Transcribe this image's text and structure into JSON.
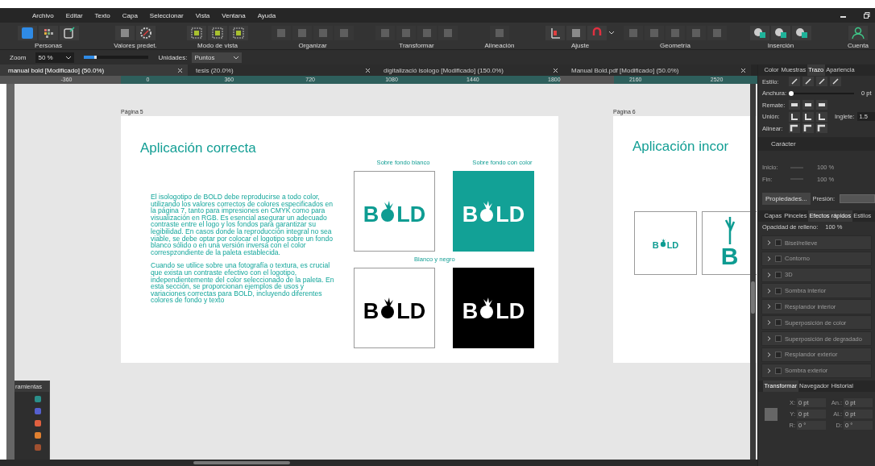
{
  "menu": [
    "Archivo",
    "Editar",
    "Texto",
    "Capa",
    "Seleccionar",
    "Vista",
    "Ventana",
    "Ayuda"
  ],
  "toolbar": [
    {
      "label": "Personas",
      "disabled": false
    },
    {
      "label": "Valores predet.",
      "disabled": false
    },
    {
      "label": "Modo de vista",
      "disabled": false
    },
    {
      "label": "Organizar",
      "disabled": true
    },
    {
      "label": "Transformar",
      "disabled": true
    },
    {
      "label": "Alineación",
      "disabled": true
    },
    {
      "label": "Ajuste",
      "disabled": false
    },
    {
      "label": "Geometría",
      "disabled": true
    },
    {
      "label": "Inserción",
      "disabled": false
    },
    {
      "label": "Cuenta",
      "disabled": false
    }
  ],
  "context_bar": {
    "zoom_label": "Zoom",
    "zoom_value": "50 %",
    "zoom_slider": {
      "level": 0.2
    },
    "units_label": "Unidades:",
    "units_value": "Puntos"
  },
  "doc_tabs": [
    {
      "title": "manual bold [Modificado] (50.0%)",
      "selected": true
    },
    {
      "title": "tesis (20.0%)",
      "selected": false
    },
    {
      "title": "digitalizació isologo [Modificado] (150.0%)",
      "selected": false
    },
    {
      "title": "Manual Bold.pdf [Modificado] (50.0%)",
      "selected": false
    }
  ],
  "ruler": [
    "-360",
    "0",
    "360",
    "720",
    "1080",
    "1440",
    "1800",
    "2160",
    "2520"
  ],
  "page_5": {
    "label": "Página 5",
    "heading": "Aplicación correcta",
    "paragraphs": [
      "El isologotipo de BOLD debe reproducirse a todo color, utilizando los valores correctos de colores especificados en la página 7, tanto para impresiones en CMYK como para visualización en RGB. Es esencial asegurar un adecuado contraste entre el logo y los fondos para garantizar su legibilidad. En casos donde la reproducción integral no sea viable, se debe optar por colocar el logotipo sobre un fondo blanco sólido o en una versión inversa con el color correspzondiente de la paleta establecida.",
      "Cuando se utilice sobre una fotografía o textura, es crucial que exista un contraste efectivo con el logotipo, independientemente del color seleccionado de la paleta. En esta sección, se proporcionan ejemplos de usos y variaciones correctas para BOLD, incluyendo diferentes colores de fondo y texto"
    ],
    "sample_groups": [
      {
        "captions": [
          "Sobre fondo blanco",
          "Sobre fondo con color"
        ],
        "logos": [
          {
            "kind": "on-white",
            "lead": "B",
            "tail": "LD"
          },
          {
            "kind": "on-color",
            "lead": "B",
            "tail": "LD"
          }
        ]
      },
      {
        "captions": [
          "Blanco y negro"
        ],
        "logos": [
          {
            "kind": "mono",
            "lead": "B",
            "tail": "LD"
          },
          {
            "kind": "mono-inverse",
            "lead": "B",
            "tail": "LD"
          }
        ]
      }
    ]
  },
  "page_6": {
    "label": "Página 6",
    "heading": "Aplicación incor",
    "logos": [
      {
        "kind": "small",
        "lead": "B",
        "tail": "LD"
      },
      {
        "kind": "vertical",
        "lead": "B"
      }
    ]
  },
  "tools_panel": {
    "title": "ramientas"
  },
  "stroke_panel": {
    "tabs": [
      {
        "label": "Color",
        "selected": false
      },
      {
        "label": "Muestras",
        "selected": false
      },
      {
        "label": "Trazo",
        "selected": true
      },
      {
        "label": "Apariencia",
        "selected": false
      }
    ],
    "style_label": "Estilo:",
    "width_label": "Anchura:",
    "width_slider": {
      "level": 0
    },
    "width_value": "0 pt",
    "cap_label": "Remate:",
    "join_label": "Unión:",
    "miter_label": "Inglete:",
    "miter_value": "1.5",
    "align_label": "Alinear:"
  },
  "character_panel": {
    "title": "Carácter"
  },
  "arrows": {
    "start_label": "Inicio:",
    "start_scale": "100 %",
    "end_label": "Fin:",
    "end_scale": "100 %",
    "properties_button": "Propiedades...",
    "pressure_label": "Presión:"
  },
  "effects_panel": {
    "tabs": [
      {
        "label": "Capas",
        "selected": false
      },
      {
        "label": "Pinceles",
        "selected": false
      },
      {
        "label": "Efectos rápidos",
        "selected": true
      },
      {
        "label": "Estilos",
        "selected": false
      }
    ],
    "opacity_label": "Opacidad de relleno:",
    "opacity_value": "100 %",
    "effects": [
      {
        "label": "Bisel/relieve",
        "checked": false,
        "disabled": true
      },
      {
        "label": "Contorno",
        "checked": false,
        "disabled": true
      },
      {
        "label": "3D",
        "checked": false,
        "disabled": true
      },
      {
        "label": "Sombra interior",
        "checked": false,
        "disabled": true
      },
      {
        "label": "Resplandor interior",
        "checked": false,
        "disabled": true
      },
      {
        "label": "Superposición de color",
        "checked": false,
        "disabled": true
      },
      {
        "label": "Superposición de degradado",
        "checked": false,
        "disabled": true
      },
      {
        "label": "Resplandor exterior",
        "checked": false,
        "disabled": true
      },
      {
        "label": "Sombra exterior",
        "checked": false,
        "disabled": true
      }
    ]
  },
  "transform_panel": {
    "tabs": [
      {
        "label": "Transformar",
        "selected": true
      },
      {
        "label": "Navegador",
        "selected": false
      },
      {
        "label": "Historial",
        "selected": false
      }
    ],
    "fields": [
      {
        "label": "X:",
        "value": "0 pt"
      },
      {
        "label": "An.:",
        "value": "0 pt"
      },
      {
        "label": "Y:",
        "value": "0 pt"
      },
      {
        "label": "Al.:",
        "value": "0 pt"
      },
      {
        "label": "R:",
        "value": "0 °"
      },
      {
        "label": "D:",
        "value": "0 °"
      }
    ]
  }
}
